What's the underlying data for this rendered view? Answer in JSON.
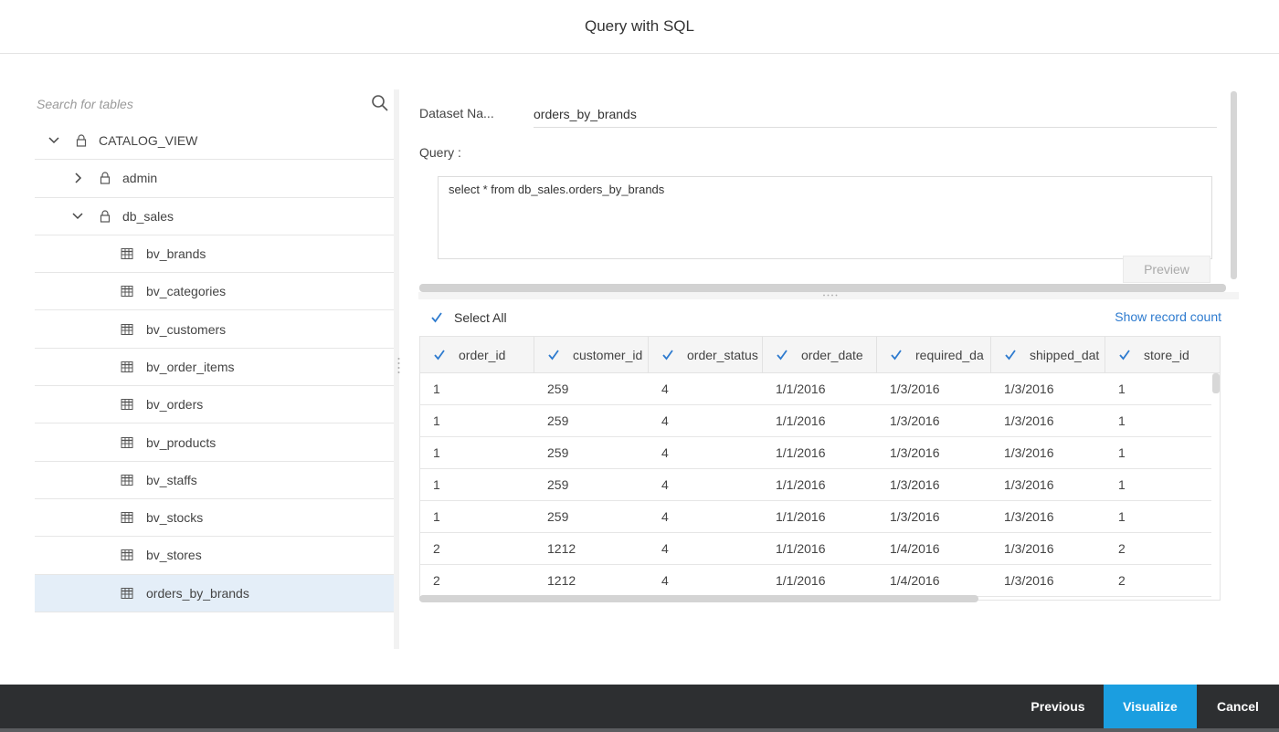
{
  "dialog": {
    "title": "Query with SQL"
  },
  "search": {
    "placeholder": "Search for tables"
  },
  "tree": {
    "root": {
      "label": "CATALOG_VIEW"
    },
    "schemas": [
      {
        "label": "admin",
        "expanded": false
      },
      {
        "label": "db_sales",
        "expanded": true
      }
    ],
    "tables": [
      {
        "label": "bv_brands"
      },
      {
        "label": "bv_categories"
      },
      {
        "label": "bv_customers"
      },
      {
        "label": "bv_order_items"
      },
      {
        "label": "bv_orders"
      },
      {
        "label": "bv_products"
      },
      {
        "label": "bv_staffs"
      },
      {
        "label": "bv_stocks"
      },
      {
        "label": "bv_stores"
      },
      {
        "label": "orders_by_brands",
        "selected": true
      }
    ]
  },
  "dataset": {
    "label": "Dataset Na...",
    "value": "orders_by_brands"
  },
  "query": {
    "label": "Query :",
    "text": "select * from db_sales.orders_by_brands",
    "preview_label": "Preview"
  },
  "results": {
    "select_all_label": "Select All",
    "show_record_count_label": "Show record count",
    "columns": [
      "order_id",
      "customer_id",
      "order_status",
      "order_date",
      "required_da",
      "shipped_dat",
      "store_id"
    ],
    "rows": [
      [
        "1",
        "259",
        "4",
        "1/1/2016",
        "1/3/2016",
        "1/3/2016",
        "1"
      ],
      [
        "1",
        "259",
        "4",
        "1/1/2016",
        "1/3/2016",
        "1/3/2016",
        "1"
      ],
      [
        "1",
        "259",
        "4",
        "1/1/2016",
        "1/3/2016",
        "1/3/2016",
        "1"
      ],
      [
        "1",
        "259",
        "4",
        "1/1/2016",
        "1/3/2016",
        "1/3/2016",
        "1"
      ],
      [
        "1",
        "259",
        "4",
        "1/1/2016",
        "1/3/2016",
        "1/3/2016",
        "1"
      ],
      [
        "2",
        "1212",
        "4",
        "1/1/2016",
        "1/4/2016",
        "1/3/2016",
        "2"
      ],
      [
        "2",
        "1212",
        "4",
        "1/1/2016",
        "1/4/2016",
        "1/3/2016",
        "2"
      ]
    ]
  },
  "footer": {
    "previous_label": "Previous",
    "visualize_label": "Visualize",
    "cancel_label": "Cancel"
  },
  "colors": {
    "accent": "#1b9ee0",
    "link": "#2e7bcf",
    "footer_bg": "#2d2f31",
    "selected_row": "#e4eef8"
  },
  "icons": [
    "search-icon",
    "chevron-down-icon",
    "chevron-right-icon",
    "lock-icon",
    "table-icon",
    "checkbox-checked-icon"
  ]
}
